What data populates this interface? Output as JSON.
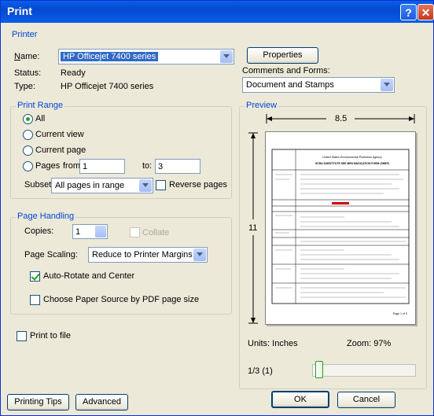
{
  "window": {
    "title": "Print",
    "help_glyph": "?",
    "close_glyph": "✕"
  },
  "printer": {
    "legend": "Printer",
    "name_label": "Name:",
    "name_value": "HP Officejet 7400 series",
    "status_label": "Status:",
    "status_value": "Ready",
    "type_label": "Type:",
    "type_value": "HP Officejet 7400 series",
    "properties_button": "Properties",
    "comments_label": "Comments and Forms:",
    "comments_value": "Document and Stamps"
  },
  "print_range": {
    "legend": "Print Range",
    "all": "All",
    "current_view": "Current view",
    "current_page": "Current page",
    "pages_label": "Pages",
    "from_label": "from:",
    "from_value": "1",
    "to_label": "to:",
    "to_value": "3",
    "subset_label": "Subset:",
    "subset_value": "All pages in range",
    "reverse_pages": "Reverse pages",
    "selected": "All"
  },
  "page_handling": {
    "legend": "Page Handling",
    "copies_label": "Copies:",
    "copies_value": "1",
    "collate_label": "Collate",
    "scaling_label": "Page Scaling:",
    "scaling_value": "Reduce to Printer Margins",
    "auto_rotate": "Auto-Rotate and Center",
    "auto_rotate_checked": true,
    "choose_paper": "Choose Paper Source by PDF page size",
    "choose_paper_checked": false
  },
  "print_to_file": {
    "label": "Print to file",
    "checked": false
  },
  "preview": {
    "legend": "Preview",
    "width_label": "8.5",
    "height_label": "11",
    "units": "Units: Inches",
    "zoom": "Zoom:  97%",
    "page_indicator": "1/3 (1)",
    "doc_agency": "United States Environmental Protection Agency",
    "doc_title": "SCRA SUBSTITUTE SEE MEN MAGICATION FORM (SMEF)",
    "doc_footer": "Page 1 of 3"
  },
  "buttons": {
    "printing_tips": "Printing Tips",
    "advanced": "Advanced",
    "ok": "OK",
    "cancel": "Cancel"
  },
  "colors": {
    "titlebar": "#0a5fe6",
    "legend_text": "#0046d5",
    "dialog_bg": "#ece9d8",
    "selection": "#316ac5"
  }
}
